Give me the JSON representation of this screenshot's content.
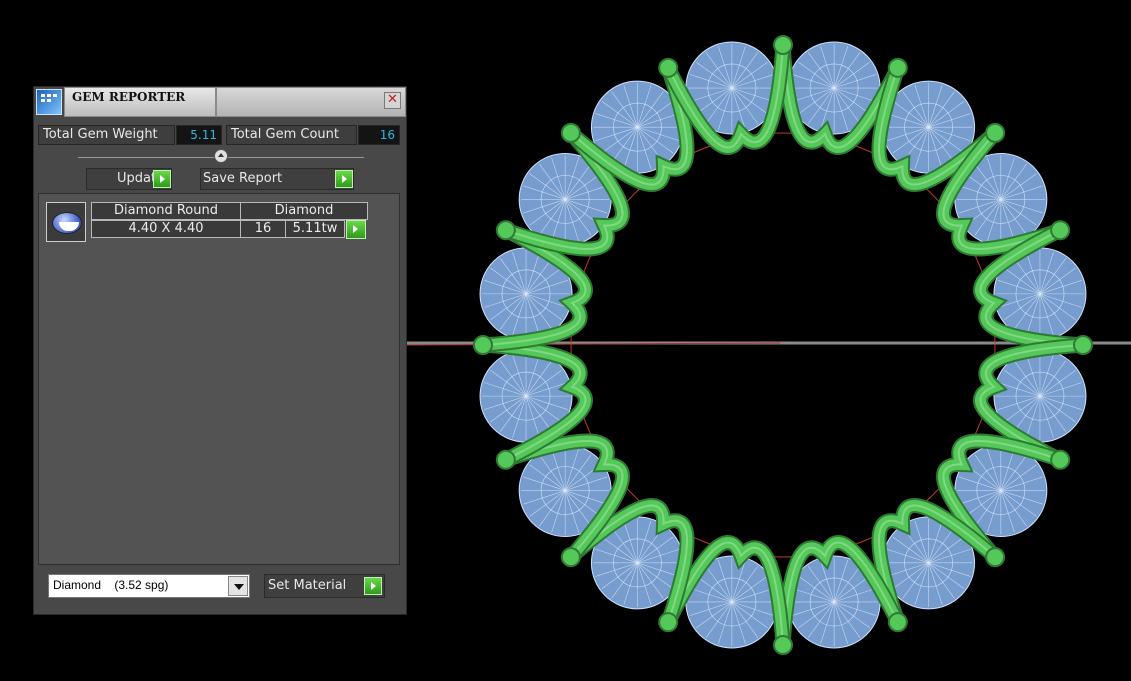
{
  "colors": {
    "panel_bg": "#484848",
    "value_text": "#2ab8e8",
    "prong_green": "#55c85a",
    "gem_blue": "#8cb8f2",
    "accent_arrow": "#3eaa28"
  },
  "reporter": {
    "title": "GEM REPORTER",
    "close_icon": "close-icon",
    "total_weight_label": "Total Gem Weight",
    "total_weight_value": "5.11",
    "total_count_label": "Total Gem Count",
    "total_count_value": "16",
    "update_label": "Update",
    "save_report_label": "Save Report",
    "gem_row": {
      "name": "Diamond Round",
      "material": "Diamond",
      "size": "4.40 X 4.40",
      "count": "16",
      "weight": "5.11tw"
    },
    "material_select": "Diamond    (3.52 spg)",
    "set_material_label": "Set Material"
  },
  "viewport": {
    "model": "eternity-ring",
    "stone_count": 16
  }
}
